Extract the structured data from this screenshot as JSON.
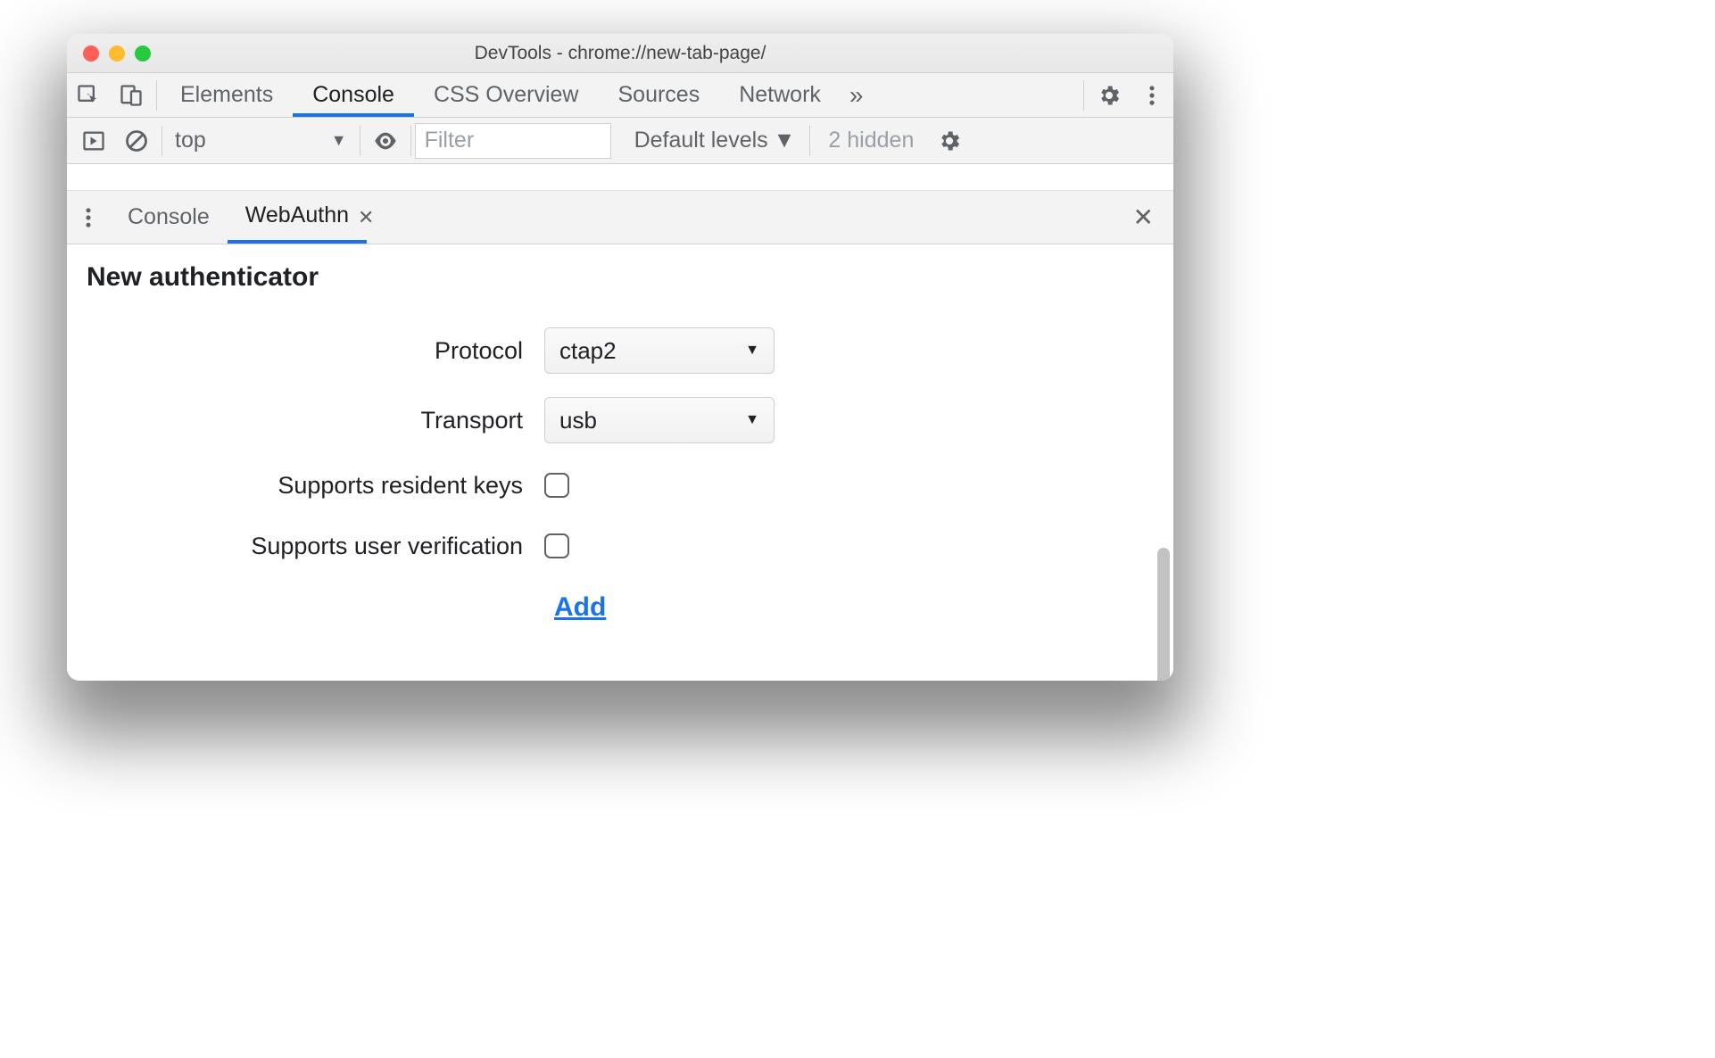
{
  "window": {
    "title": "DevTools - chrome://new-tab-page/"
  },
  "tabs": {
    "elements": "Elements",
    "console": "Console",
    "css_overview": "CSS Overview",
    "sources": "Sources",
    "network": "Network"
  },
  "console_bar": {
    "context": "top",
    "filter_placeholder": "Filter",
    "levels": "Default levels",
    "hidden": "2 hidden"
  },
  "drawer": {
    "console": "Console",
    "webauthn": "WebAuthn"
  },
  "panel": {
    "heading": "New authenticator",
    "protocol_label": "Protocol",
    "protocol_value": "ctap2",
    "transport_label": "Transport",
    "transport_value": "usb",
    "resident_label": "Supports resident keys",
    "userverif_label": "Supports user verification",
    "add": "Add"
  }
}
